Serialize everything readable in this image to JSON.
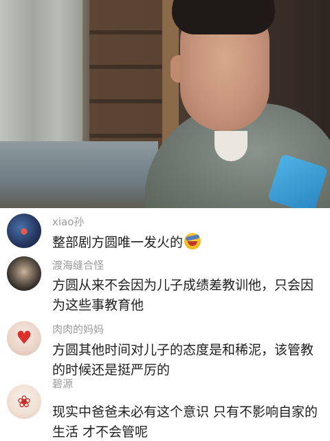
{
  "comments": [
    {
      "username": "xiao孙",
      "text": "整部剧方圆唯一发火的",
      "avatar_icon": "dark-blue-circle-avatar",
      "avatar_color": "#2a3b63",
      "emoji": "laughing-crying-emoji"
    },
    {
      "username": "渡海缝合怪",
      "text": "方圆从来不会因为儿子成绩差教训他，只会因为这些事教育他",
      "avatar_icon": "person-portrait-avatar",
      "avatar_color": "#3c3a36"
    },
    {
      "username": "肉肉的妈妈",
      "text": "方圆其他时间对儿子的态度是和稀泥，该管教的时候还是挺严厉的",
      "avatar_icon": "mother-child-avatar",
      "avatar_color": "#e9d6cc"
    },
    {
      "username": "碧源",
      "text": "现实中爸爸未必有这个意识 只有不影响自家的生活 才不会管呢",
      "avatar_icon": "cartoon-girl-avatar",
      "avatar_color": "#f1e4da"
    }
  ]
}
